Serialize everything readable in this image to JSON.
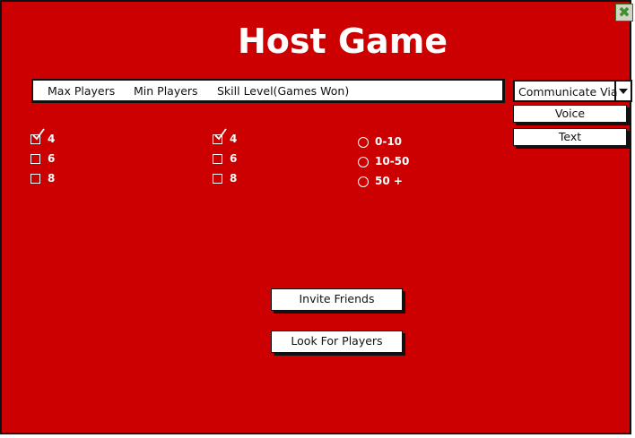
{
  "window": {
    "title": "Host Game",
    "close_glyph": "✖"
  },
  "tabs": [
    {
      "label": "Max Players"
    },
    {
      "label": "Min Players"
    },
    {
      "label": "Skill Level(Games Won)"
    }
  ],
  "communicate": {
    "selected": "Communicate Via",
    "options": [
      {
        "label": "Voice"
      },
      {
        "label": "Text"
      }
    ]
  },
  "max_players": [
    {
      "label": "4",
      "checked": true
    },
    {
      "label": "6",
      "checked": false
    },
    {
      "label": "8",
      "checked": false
    }
  ],
  "min_players": [
    {
      "label": "4",
      "checked": true
    },
    {
      "label": "6",
      "checked": false
    },
    {
      "label": "8",
      "checked": false
    }
  ],
  "skill_levels": [
    {
      "label": "0-10",
      "selected": false
    },
    {
      "label": "10-50",
      "selected": false
    },
    {
      "label": "50 +",
      "selected": false
    }
  ],
  "actions": {
    "invite_label": "Invite Friends",
    "look_label": "Look For Players"
  },
  "colors": {
    "background": "#cc0000",
    "text_light": "#ffffff",
    "close_icon": "#3f8f2f"
  }
}
